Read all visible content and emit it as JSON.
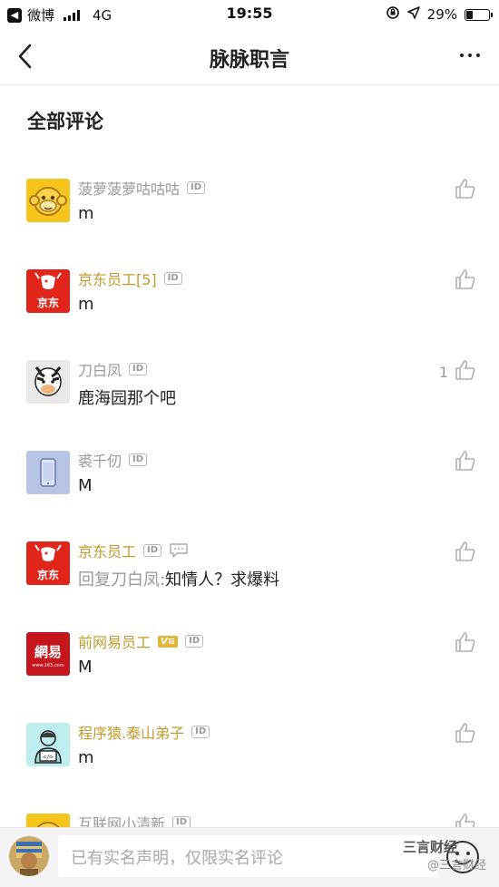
{
  "status_bar": {
    "carrier": "微博",
    "network": "4G",
    "time": "19:55",
    "battery": "29%",
    "battery_level": 0.29
  },
  "nav": {
    "title": "脉脉职言"
  },
  "section": {
    "title": "全部评论"
  },
  "badges": {
    "id": "ID",
    "verified": "V≡"
  },
  "comments": [
    {
      "name": "菠萝菠萝咕咕咕",
      "name_color": "gray",
      "text": "m",
      "likes": "",
      "avatar": "monkey-avatar"
    },
    {
      "name": "京东员工[5]",
      "name_color": "gold",
      "text": "m",
      "likes": "",
      "avatar": "jd-avatar"
    },
    {
      "name": "刀白凤",
      "name_color": "gray",
      "text": "鹿海园那个吧",
      "likes": "1",
      "avatar": "zebra-avatar"
    },
    {
      "name": "裘千仞",
      "name_color": "gray",
      "text": "M",
      "likes": "",
      "avatar": "phone-avatar"
    },
    {
      "name": "京东员工",
      "name_color": "gold",
      "reply_prefix": "回复刀白凤:",
      "text": "知情人？求爆料",
      "likes": "",
      "avatar": "jd-avatar"
    },
    {
      "name": "前网易员工",
      "name_color": "gold",
      "text": "M",
      "likes": "",
      "avatar": "netease-avatar"
    },
    {
      "name": "程序猿.泰山弟子",
      "name_color": "gold",
      "text": "m",
      "likes": "",
      "avatar": "coder-avatar"
    },
    {
      "name": "互联网小清新",
      "name_color": "gray",
      "text": "",
      "likes": "",
      "avatar": "monkey-avatar"
    }
  ],
  "avatar_text": {
    "jd": "京东",
    "netease": "網易",
    "netease_sub": "www.163.com",
    "coder": "</>"
  },
  "bottom_bar": {
    "input_placeholder": "已有实名声明，仅限实名评论",
    "watermark_top": "三言财经",
    "watermark": "@三言财经"
  },
  "colors": {
    "gold_name": "#c49a2c",
    "gray_name": "#9a9a9a",
    "jd_red": "#e1251b",
    "netease_red": "#c4161c",
    "monkey_yellow": "#f5c51c"
  }
}
